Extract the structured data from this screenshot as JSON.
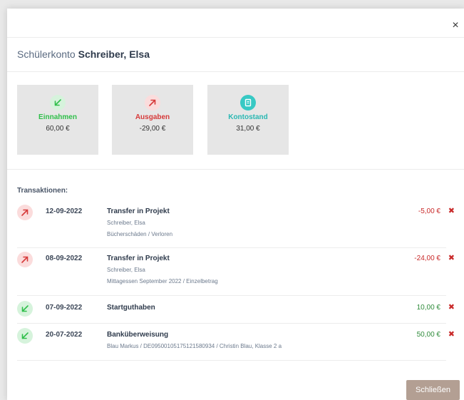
{
  "modal": {
    "close_glyph": "×",
    "title_prefix": "Schülerkonto",
    "title_name": "Schreiber, Elsa",
    "close_button": "Schließen"
  },
  "summary": [
    {
      "label": "Einnahmen",
      "amount": "60,00 €",
      "color": "#2fbf4a",
      "icon": "arrow-down-left-icon"
    },
    {
      "label": "Ausgaben",
      "amount": "-29,00 €",
      "color": "#d63a3a",
      "icon": "arrow-up-right-icon"
    },
    {
      "label": "Kontostand",
      "amount": "31,00 €",
      "color": "#2ab8b3",
      "icon": "balance-icon"
    }
  ],
  "transactions_label": "Transaktionen:",
  "transactions": [
    {
      "type": "out",
      "date": "12-09-2022",
      "title": "Transfer in Projekt",
      "line1": "Schreiber, Elsa",
      "line2": "Bücherschäden / Verloren",
      "amount": "-5,00 €"
    },
    {
      "type": "out",
      "date": "08-09-2022",
      "title": "Transfer in Projekt",
      "line1": "Schreiber, Elsa",
      "line2": "Mittagessen September 2022 / Einzelbetrag",
      "amount": "-24,00 €"
    },
    {
      "type": "in",
      "date": "07-09-2022",
      "title": "Startguthaben",
      "line1": "",
      "line2": "",
      "amount": "10,00 €"
    },
    {
      "type": "in",
      "date": "20-07-2022",
      "title": "Banküberweisung",
      "line1": "Blau Markus / DE09500105175121580934 / Christin Blau, Klasse 2 a",
      "line2": "",
      "amount": "50,00 €"
    }
  ]
}
